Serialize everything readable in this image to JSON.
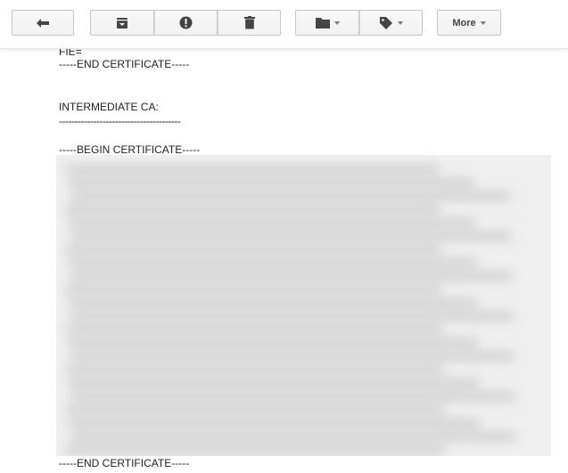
{
  "toolbar": {
    "back_icon": "reply-arrow-icon",
    "archive_icon": "archive-icon",
    "spam_icon": "report-spam-icon",
    "delete_icon": "trash-icon",
    "move_icon": "folder-icon",
    "labels_icon": "tag-icon",
    "more_label": "More"
  },
  "email": {
    "line_prev_tail": "FIE=",
    "end_cert_1": "-----END CERTIFICATE-----",
    "intermediate_heading": "INTERMEDIATE CA:",
    "separator": "---------------------------------------",
    "begin_cert": "-----BEGIN CERTIFICATE-----",
    "end_cert_2": "-----END CERTIFICATE-----"
  },
  "colors": {
    "button_bg": "#f5f5f5",
    "button_border": "#c6c6c6",
    "icon": "#444444",
    "text": "#222222",
    "blur_bg": "#efefef"
  }
}
